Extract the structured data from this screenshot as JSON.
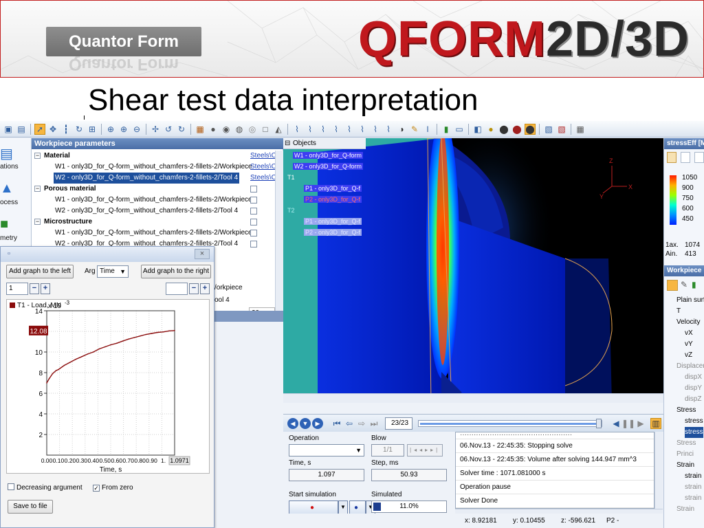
{
  "banner": {
    "company_logo": "Quantor Form",
    "product_title_part1": "QFORM",
    "product_title_part2": "2D/3D"
  },
  "slide_title": "Shear test data interpretation",
  "left_strip": [
    {
      "label": "ations",
      "icon": "document-icon"
    },
    {
      "label": "ocess",
      "icon": "process-icon"
    },
    {
      "label": "metry",
      "icon": "geometry-icon"
    }
  ],
  "workpiece_panel": {
    "title": "Workpiece parameters",
    "rows": [
      {
        "text": "Material",
        "kind": "group",
        "value": "Steels\\C"
      },
      {
        "text": "W1 - only3D_for_Q-form_without_chamfers-2-fillets-2/Workpiece",
        "kind": "child",
        "value": "Steels\\C"
      },
      {
        "text": "W2 - only3D_for_Q-form_without_chamfers-2-fillets-2/Tool 4",
        "kind": "child-selected",
        "value": "Steels\\C"
      },
      {
        "text": "Porous material",
        "kind": "group"
      },
      {
        "text": "W1 - only3D_for_Q-form_without_chamfers-2-fillets-2/Workpiece",
        "kind": "child"
      },
      {
        "text": "W2 - only3D_for_Q-form_without_chamfers-2-fillets-2/Tool 4",
        "kind": "child"
      },
      {
        "text": "Microstructure",
        "kind": "group"
      },
      {
        "text": "W1 - only3D_for_Q-form_without_chamfers-2-fillets-2/Workpiece",
        "kind": "child"
      },
      {
        "text": "W2 - only3D_for_Q-form_without_chamfers-2-fillets-2/Tool 4",
        "kind": "child"
      }
    ],
    "hidden_row_suffix_1": "/orkpiece",
    "hidden_row_suffix_2": "ool 4",
    "count_value": "20"
  },
  "graph_window": {
    "add_left_label": "Add graph to the left",
    "arg_label": "Arg",
    "arg_value": "Time",
    "add_right_label": "Add graph to the right",
    "left_input_value": "1",
    "right_input_value": "",
    "plus_label": "+",
    "minus_label": "−",
    "close_label": "×",
    "decreasing_argument_label": "Decreasing argument",
    "from_zero_label": "From zero",
    "save_label": "Save to file"
  },
  "chart_data": {
    "type": "line",
    "series": [
      {
        "name": "T1 - Load, MN",
        "x": [
          0.0,
          0.02,
          0.05,
          0.08,
          0.1,
          0.15,
          0.2,
          0.25,
          0.3,
          0.35,
          0.4,
          0.45,
          0.5,
          0.55,
          0.6,
          0.65,
          0.7,
          0.75,
          0.8,
          0.85,
          0.9,
          0.95,
          1.0,
          1.05,
          1.0971
        ],
        "y": [
          7.0,
          7.4,
          7.9,
          8.2,
          8.3,
          8.7,
          9.0,
          9.3,
          9.55,
          9.8,
          10.0,
          10.3,
          10.5,
          10.7,
          10.85,
          11.05,
          11.25,
          11.4,
          11.55,
          11.7,
          11.8,
          11.9,
          11.95,
          12.05,
          12.08
        ]
      }
    ],
    "title": "",
    "xlabel": "Time, s",
    "ylabel": "",
    "y_multiplier": "x 10",
    "y_multiplier_exp": "-3",
    "xlim": [
      0,
      1.0971
    ],
    "ylim": [
      0,
      14
    ],
    "x_ticks": [
      "0.00",
      "0.10",
      "0.20",
      "0.30",
      "0.40",
      "0.50",
      "0.60",
      "0.70",
      "0.80",
      "0.90",
      "1."
    ],
    "x_end_value": "1.0971",
    "y_ticks": [
      2,
      4,
      6,
      8,
      10,
      12,
      14
    ],
    "y_ticks_labeled": [
      "2",
      "4",
      "6",
      "8",
      "10",
      "12",
      "14"
    ],
    "current_value_label": "12.08",
    "grid": true,
    "legend_placement": "top-left",
    "line_color": "#8a0b0b"
  },
  "objects_panel": {
    "title": "Objects",
    "items": [
      {
        "text": "W1 - only3D_for_Q-form",
        "style": "selected"
      },
      {
        "text": "W2 - only3D_for_Q-form",
        "style": "selected"
      },
      {
        "text": "T1",
        "style": "plain"
      },
      {
        "text": "P1 - only3D_for_Q-f",
        "style": "selected"
      },
      {
        "text": "P2 - only3D_for_Q-f",
        "style": "selected-red"
      },
      {
        "text": "T2",
        "style": "faded-plain"
      },
      {
        "text": "P1 - only3D_for_Q-f",
        "style": "faded"
      },
      {
        "text": "P2 - only3D_for_Q-f",
        "style": "faded"
      }
    ]
  },
  "viewport": {
    "axis_labels": {
      "z": "Z",
      "y": "Y",
      "x": "X"
    }
  },
  "player": {
    "frame_counter": "23/23"
  },
  "stats": {
    "operation_label": "Operation",
    "operation_value": "",
    "blow_label": "Blow",
    "blow_value": "1/1",
    "time_label": "Time, s",
    "time_value": "1.097",
    "step_label": "Step, ms",
    "step_value": "50.93",
    "start_simulation_label": "Start simulation",
    "simulated_label": "Simulated",
    "simulated_value": "11.0%",
    "simulated_progress": 0.11
  },
  "log": [
    "06.Nov.13 - 22:45:35: Stopping solve",
    "06.Nov.13 - 22:45:35: Volume after solving 144.947 mm^3",
    "Solver time : 1071.081000 s",
    "Operation pause",
    "Solver Done"
  ],
  "status_bar": {
    "x": "x: 8.92181",
    "y": "y: 0.10455",
    "z": "z: -596.621",
    "object": "P2 - only3D_for_Q-"
  },
  "right_panel": {
    "scale_title": "stressEff [M",
    "scale_values": [
      "1050",
      "900",
      "750",
      "600",
      "450"
    ],
    "max_label": "1ax.",
    "max_value": "1074",
    "min_label": "Ain.",
    "min_value": "413",
    "workpiece_title": "Workpiece",
    "tree": [
      {
        "text": "Plain surf",
        "indent": 18,
        "style": "normal"
      },
      {
        "text": "T",
        "indent": 18,
        "style": "normal"
      },
      {
        "text": "Velocity",
        "indent": 18,
        "style": "normal"
      },
      {
        "text": "vX",
        "indent": 30,
        "style": "normal"
      },
      {
        "text": "vY",
        "indent": 30,
        "style": "normal"
      },
      {
        "text": "vZ",
        "indent": 30,
        "style": "normal"
      },
      {
        "text": "Displacen",
        "indent": 18,
        "style": "dim"
      },
      {
        "text": "dispX",
        "indent": 30,
        "style": "dim"
      },
      {
        "text": "dispY",
        "indent": 30,
        "style": "dim"
      },
      {
        "text": "dispZ",
        "indent": 30,
        "style": "dim"
      },
      {
        "text": "Stress",
        "indent": 18,
        "style": "normal"
      },
      {
        "text": "stress",
        "indent": 30,
        "style": "normal"
      },
      {
        "text": "stress",
        "indent": 30,
        "style": "sel"
      },
      {
        "text": "Stress",
        "indent": 18,
        "style": "dim"
      },
      {
        "text": "Princi",
        "indent": 18,
        "style": "dim"
      },
      {
        "text": "Strain",
        "indent": 18,
        "style": "normal"
      },
      {
        "text": "strain",
        "indent": 30,
        "style": "normal"
      },
      {
        "text": "strain",
        "indent": 30,
        "style": "dim"
      },
      {
        "text": "strain",
        "indent": 30,
        "style": "dim"
      },
      {
        "text": "Strain",
        "indent": 18,
        "style": "dim"
      }
    ]
  }
}
